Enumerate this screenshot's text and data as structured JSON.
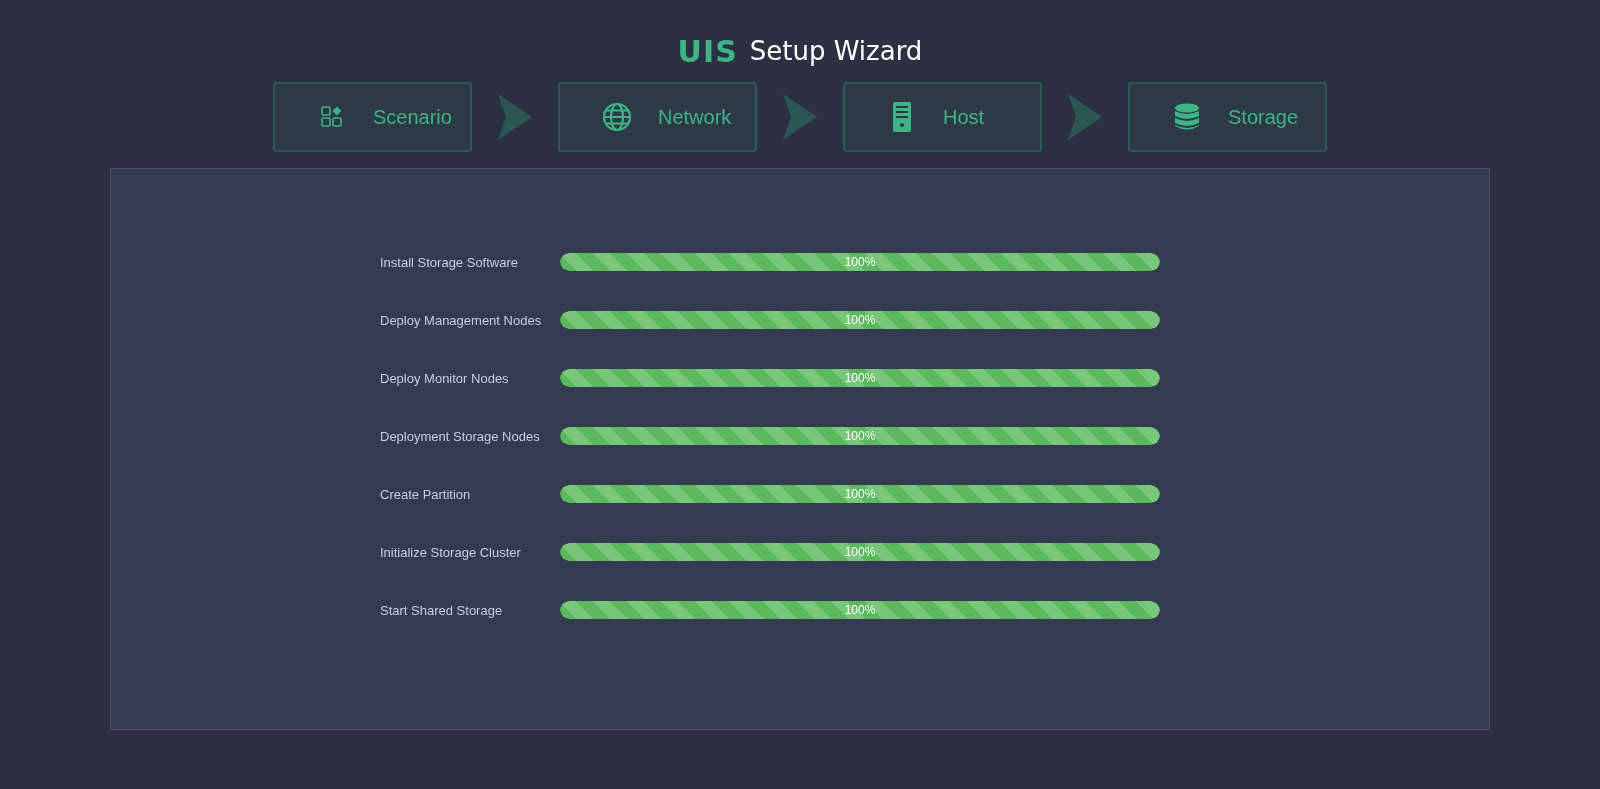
{
  "header": {
    "logo": "UIS",
    "title": "Setup Wizard"
  },
  "steps": [
    {
      "kind": "scenario",
      "label": "Scenario"
    },
    {
      "kind": "network",
      "label": "Network"
    },
    {
      "kind": "host",
      "label": "Host"
    },
    {
      "kind": "storage",
      "label": "Storage"
    }
  ],
  "tasks": [
    {
      "label": "Install Storage Software",
      "level": 1,
      "reading": "100%"
    },
    {
      "label": "Deploy Management Nodes",
      "level": 1,
      "reading": "100%"
    },
    {
      "label": "Deploy Monitor Nodes",
      "level": 1,
      "reading": "100%"
    },
    {
      "label": "Deployment Storage Nodes",
      "level": 1,
      "reading": "100%"
    },
    {
      "label": "Create Partition",
      "level": 1,
      "reading": "100%"
    },
    {
      "label": "Initialize Storage Cluster",
      "level": 1,
      "reading": "100%"
    },
    {
      "label": "Start Shared Storage",
      "level": 1,
      "reading": "100%"
    }
  ]
}
